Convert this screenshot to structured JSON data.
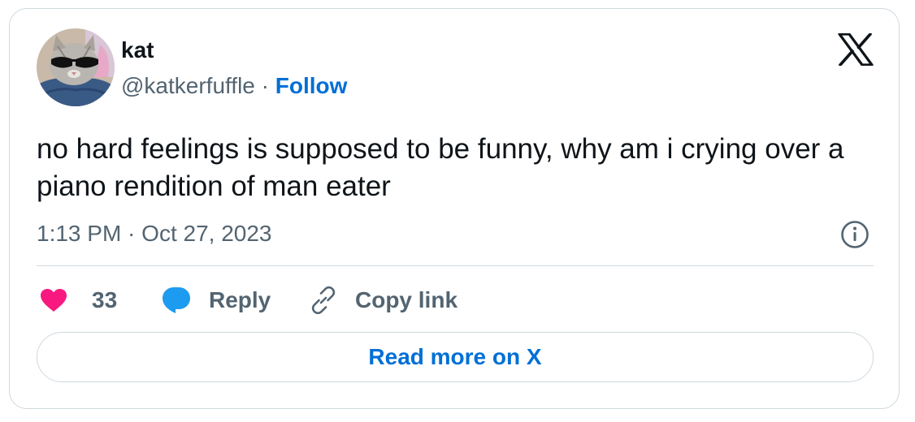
{
  "author": {
    "name": "kat",
    "handle": "@katkerfuffle",
    "separator": " · ",
    "follow_label": "Follow"
  },
  "tweet": {
    "text": "no hard feelings is supposed to be funny, why am i crying over a piano rendition of man eater",
    "timestamp": "1:13 PM · Oct 27, 2023"
  },
  "actions": {
    "like_count": "33",
    "reply_label": "Reply",
    "copy_link_label": "Copy link"
  },
  "read_more_label": "Read more on X",
  "icons": {
    "brand": "x-logo-icon",
    "info": "info-icon",
    "like": "heart-icon",
    "reply": "speech-bubble-icon",
    "copy": "link-icon"
  },
  "colors": {
    "text": "#0f1419",
    "secondary": "#536471",
    "link": "#006fd6",
    "heart": "#f91880",
    "reply_bubble": "#1d9bf0",
    "border": "#cfd9de"
  }
}
